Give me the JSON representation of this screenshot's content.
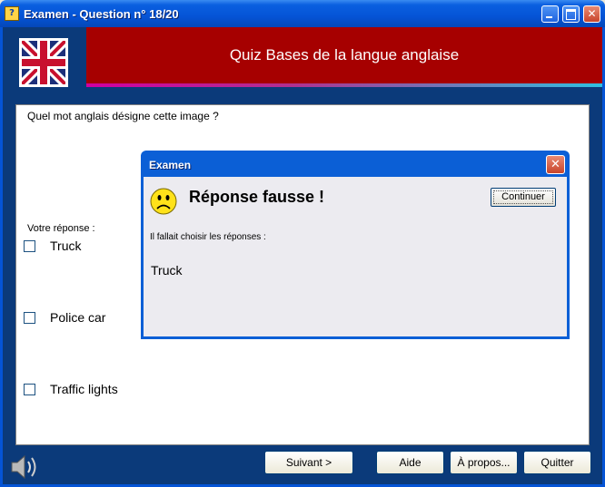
{
  "window": {
    "title": "Examen - Question n° 18/20"
  },
  "header": {
    "banner_title": "Quiz Bases de la langue anglaise"
  },
  "question": {
    "prompt": "Quel mot anglais désigne cette image ?",
    "answer_label": "Votre réponse :",
    "options": [
      "Truck",
      "Police car",
      "Traffic lights"
    ]
  },
  "buttons": {
    "next": "Suivant >",
    "help": "Aide",
    "about": "À propos...",
    "quit": "Quitter"
  },
  "dialog": {
    "title": "Examen",
    "heading": "Réponse fausse !",
    "continue": "Continuer",
    "sub": "Il fallait choisir les réponses :",
    "correct_answer": "Truck"
  },
  "colors": {
    "banner": "#a60000",
    "frame": "#0b3a7a",
    "titlebar": "#0554d6"
  },
  "icons": [
    "uk-flag-icon",
    "speaker-icon",
    "sad-face-icon",
    "close-icon",
    "minimize-icon",
    "maximize-icon"
  ]
}
